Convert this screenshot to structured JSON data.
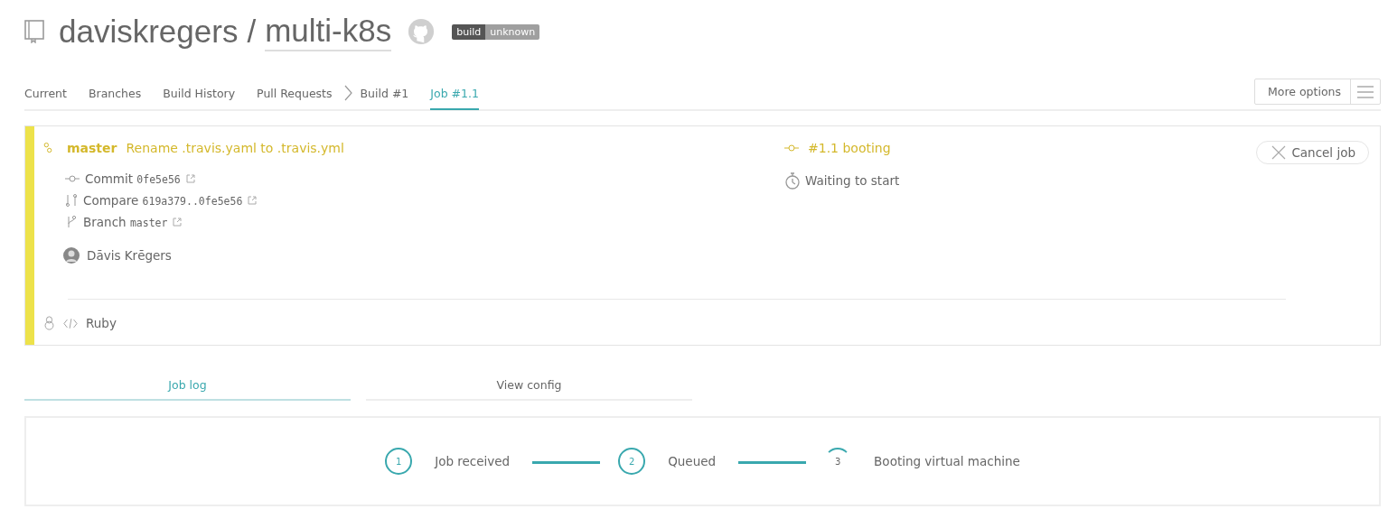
{
  "repo": {
    "owner": "daviskregers",
    "separator": "/",
    "name": "multi-k8s",
    "badge": {
      "label": "build",
      "status": "unknown"
    }
  },
  "tabs": [
    {
      "label": "Current",
      "selected": false,
      "kind": "tab"
    },
    {
      "label": "Branches",
      "selected": false,
      "kind": "tab"
    },
    {
      "label": "Build History",
      "selected": false,
      "kind": "tab"
    },
    {
      "label": "Pull Requests",
      "selected": false,
      "kind": "tab"
    },
    {
      "label": "Build #1",
      "selected": false,
      "kind": "crumb"
    },
    {
      "label": "Job #1.1",
      "selected": true,
      "kind": "tab"
    }
  ],
  "more_options": "More options",
  "job": {
    "branch": "master",
    "message": "Rename .travis.yaml to .travis.yml",
    "status": "#1.1 booting",
    "state_text": "Waiting to start",
    "cancel": "Cancel job",
    "details": [
      {
        "kind": "commit",
        "label": "Commit",
        "value": "0fe5e56"
      },
      {
        "kind": "compare",
        "label": "Compare",
        "value": "619a379..0fe5e56"
      },
      {
        "kind": "branch",
        "label": "Branch",
        "value": "master"
      }
    ],
    "author": "Dāvis Krēgers",
    "language": "Ruby"
  },
  "log_tabs": [
    {
      "label": "Job log",
      "selected": true
    },
    {
      "label": "View config",
      "selected": false
    }
  ],
  "steps": [
    {
      "number": "1",
      "label": "Job received",
      "kind": "done"
    },
    {
      "number": "2",
      "label": "Queued",
      "kind": "done"
    },
    {
      "number": "3",
      "label": "Booting virtual machine",
      "kind": "active"
    }
  ]
}
